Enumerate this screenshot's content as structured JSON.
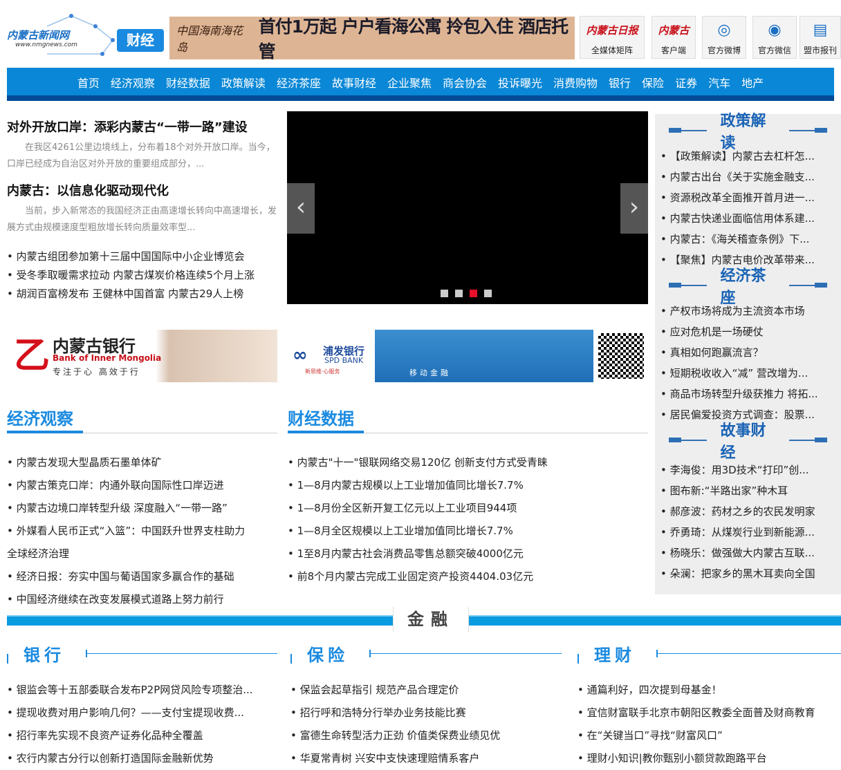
{
  "header": {
    "logo_text": "内蒙古新闻网",
    "logo_url": "www.nmgnews.com",
    "channel": "财经",
    "banner_brand": "中国海南海花岛",
    "banner_text": "首付1万起 户户看海公寓 拎包入住 酒店托管",
    "links": [
      {
        "icon": "nmg-daily-logo",
        "label": "全媒体矩阵",
        "glyph": "内蒙古日报"
      },
      {
        "icon": "app-logo",
        "label": "客户端",
        "glyph": "内蒙古"
      },
      {
        "icon": "weibo-icon",
        "label": "官方微博",
        "glyph": "◎"
      },
      {
        "icon": "wechat-icon",
        "label": "官方微信",
        "glyph": "◉"
      },
      {
        "icon": "newspaper-icon",
        "label": "盟市报刊",
        "glyph": "▤"
      }
    ]
  },
  "nav": [
    "首页",
    "经济观察",
    "财经数据",
    "政策解读",
    "经济茶座",
    "故事财经",
    "企业聚焦",
    "商会协会",
    "投诉曝光",
    "消费购物",
    "银行",
    "保险",
    "证券",
    "汽车",
    "地产"
  ],
  "headlines": [
    {
      "title": "对外开放口岸：添彩内蒙古“一带一路”建设",
      "summary": "在我区4261公里边境线上，分布着18个对外开放口岸。当今，口岸已经成为自治区对外开放的重要组成部分，..."
    },
    {
      "title": "内蒙古：以信息化驱动现代化",
      "summary": "当前，步入新常态的我国经济正由高速增长转向中高速增长，发展方式由规模速度型粗放增长转向质量效率型..."
    }
  ],
  "top_list": [
    "内蒙古组团参加第十三届中国国际中小企业博览会",
    "受冬季取暖需求拉动 内蒙古煤炭价格连续5个月上涨",
    "胡润百富榜发布 王健林中国首富 内蒙古29人上榜"
  ],
  "slider": {
    "prev": "‹",
    "next": "›",
    "active_index": 2,
    "count": 4
  },
  "ads": {
    "bank1_name": "内蒙古银行",
    "bank1_en": "Bank of Inner Mongolia",
    "bank1_slogan": "专注于心 高效于行",
    "bank2_name": "浦发银行",
    "bank2_en": "SPD BANK",
    "bank2_slogan": "新思维·心服务",
    "bank2_banner": "移动金融"
  },
  "sidebar": [
    {
      "title": "政策解读",
      "items": [
        "【政策解读】内蒙古去杠杆怎...",
        "内蒙古出台《关于实施金融支...",
        "资源税改革全面推开首月进一...",
        "内蒙古快递业面临信用体系建...",
        "内蒙古：《海关稽查条例》下...",
        "【聚焦】内蒙古电价改革带来..."
      ]
    },
    {
      "title": "经济茶座",
      "items": [
        "产权市场将成为主流资本市场",
        "应对危机是一场硬仗",
        "真相如何跑赢流言？",
        "短期税收收入“减” 营改增为...",
        "商品市场转型升级获推力 将拓...",
        "居民偏爱投资方式调查：股票..."
      ]
    },
    {
      "title": "故事财经",
      "items": [
        "李海俊：用3D技术“打印”创...",
        "图布新:“半路出家”种木耳",
        "郝彦波：药材之乡的农民发明家",
        "乔勇琦：从煤炭行业到新能源...",
        "杨晓乐：做强做大内蒙古互联...",
        "朵澜：把家乡的黑木耳卖向全国"
      ]
    }
  ],
  "sections": [
    {
      "title": "经济观察",
      "items": [
        "内蒙古发现大型晶质石墨单体矿",
        "内蒙古策克口岸：内通外联向国际性口岸迈进",
        "内蒙古边境口岸转型升级 深度融入“一带一路”",
        "外媒看人民币正式“入篮”：中国跃升世界支柱助力",
        "全球经济治理",
        "经济日报：夯实中国与葡语国家多赢合作的基础",
        "中国经济继续在改变发展模式道路上努力前行"
      ]
    },
    {
      "title": "财经数据",
      "items": [
        "内蒙古\"十一\"银联网络交易120亿 创新支付方式受青睐",
        "1—8月内蒙古规模以上工业增加值同比增长7.7%",
        "1—8月份全区新开复工亿元以上工业项目944项",
        "1—8月全区规模以上工业增加值同比增长7.7%",
        "1至8月内蒙古社会消费品零售总额突破4000亿元",
        "前8个月内蒙古完成工业固定资产投资4404.03亿元"
      ]
    }
  ],
  "finance": {
    "title": "金融",
    "cols": [
      {
        "title": "银行",
        "items": [
          "银监会等十五部委联合发布P2P网贷风险专项整治...",
          "提现收费对用户影响几何？——支付宝提现收费...",
          "招行率先实现不良资产证券化品种全覆盖",
          "农行内蒙古分行以创新打造国际金融新优势"
        ]
      },
      {
        "title": "保险",
        "items": [
          "保监会起草指引 规范产品合理定价",
          "招行呼和浩特分行举办业务技能比赛",
          "富德生命转型活力正劲 价值类保费业绩见优",
          "华夏常青树 兴安中支快速理赔情系客户"
        ]
      },
      {
        "title": "理财",
        "items": [
          "通篇利好，四次提到母基金！",
          "宜信财富联手北京市朝阳区教委全面普及财商教育",
          "在“关键当口”寻找“财富风口”",
          "理财小知识|教你甄别小额贷款跑路平台"
        ]
      }
    ]
  }
}
